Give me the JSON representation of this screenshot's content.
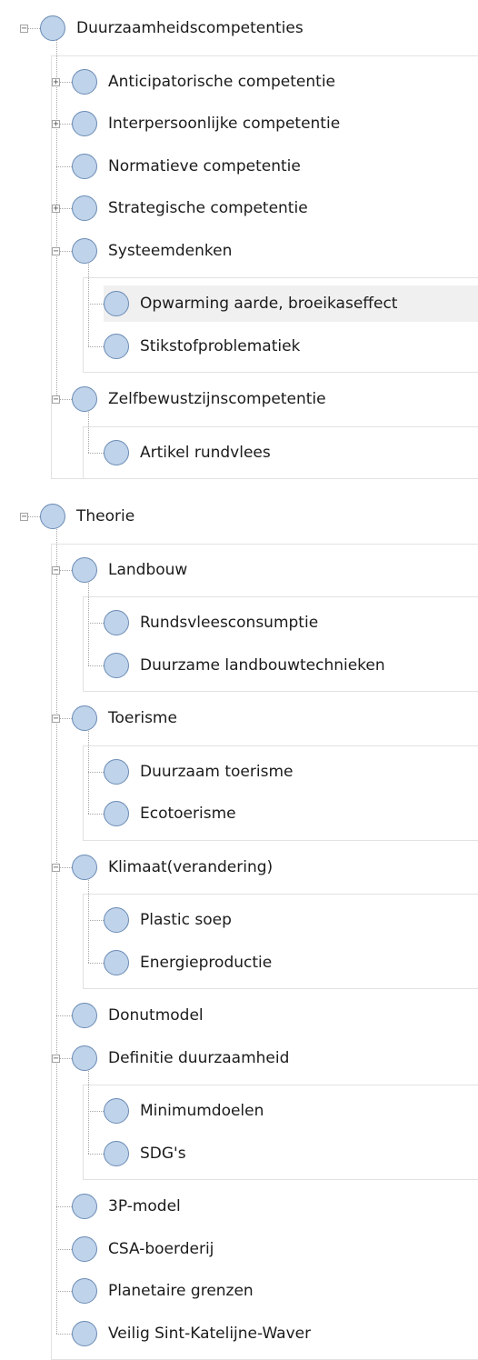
{
  "tree": [
    {
      "label": "Duurzaamheidscompetenties",
      "expander": "minus",
      "children": [
        {
          "label": "Anticipatorische competentie",
          "expander": "plus"
        },
        {
          "label": "Interpersoonlijke competentie",
          "expander": "plus"
        },
        {
          "label": "Normatieve competentie"
        },
        {
          "label": "Strategische competentie",
          "expander": "plus"
        },
        {
          "label": "Systeemdenken",
          "expander": "minus",
          "children": [
            {
              "label": "Opwarming aarde, broeikaseffect",
              "selected": true
            },
            {
              "label": "Stikstofproblematiek"
            }
          ]
        },
        {
          "label": "Zelfbewustzijnscompetentie",
          "expander": "minus",
          "children": [
            {
              "label": "Artikel rundvlees"
            }
          ]
        }
      ]
    },
    {
      "label": "Theorie",
      "expander": "minus",
      "children": [
        {
          "label": "Landbouw",
          "expander": "minus",
          "children": [
            {
              "label": "Rundsvleesconsumptie"
            },
            {
              "label": "Duurzame landbouwtechnieken"
            }
          ]
        },
        {
          "label": "Toerisme",
          "expander": "minus",
          "children": [
            {
              "label": "Duurzaam toerisme"
            },
            {
              "label": "Ecotoerisme"
            }
          ]
        },
        {
          "label": "Klimaat(verandering)",
          "expander": "minus",
          "children": [
            {
              "label": "Plastic soep"
            },
            {
              "label": "Energieproductie"
            }
          ]
        },
        {
          "label": "Donutmodel"
        },
        {
          "label": "Definitie duurzaamheid",
          "expander": "minus",
          "children": [
            {
              "label": "Minimumdoelen"
            },
            {
              "label": "SDG's"
            }
          ]
        },
        {
          "label": "3P-model"
        },
        {
          "label": "CSA-boerderij"
        },
        {
          "label": "Planetaire grenzen"
        },
        {
          "label": "Veilig Sint-Katelijne-Waver"
        }
      ]
    }
  ]
}
